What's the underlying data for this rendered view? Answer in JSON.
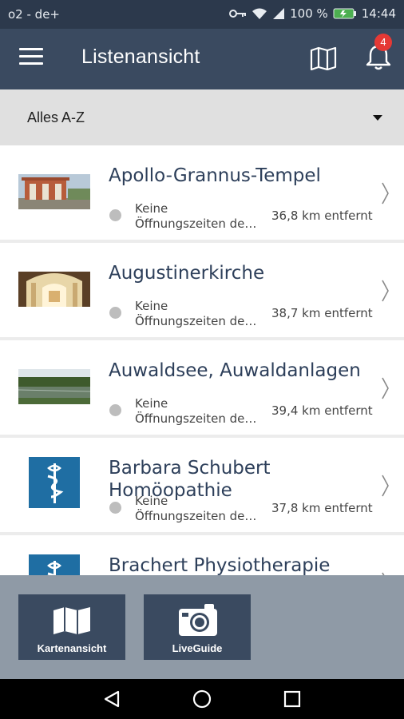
{
  "status_bar": {
    "carrier": "o2 - de+",
    "battery": "100 %",
    "time": "14:44"
  },
  "app_bar": {
    "title": "Listenansicht",
    "notification_count": "4"
  },
  "filter": {
    "selected": "Alles A-Z"
  },
  "items": [
    {
      "name": "Apollo-Grannus-Tempel",
      "hours_line1": "Keine",
      "hours_line2": "Öffnungszeiten de…",
      "distance": "36,8 km entfernt",
      "image": "photo-temple"
    },
    {
      "name": "Augustinerkirche",
      "hours_line1": "Keine",
      "hours_line2": "Öffnungszeiten de…",
      "distance": "38,7 km entfernt",
      "image": "photo-church-interior"
    },
    {
      "name": "Auwaldsee, Auwaldanlagen",
      "hours_line1": "Keine",
      "hours_line2": "Öffnungszeiten de…",
      "distance": "39,4 km entfernt",
      "image": "photo-lake"
    },
    {
      "name": "Barbara Schubert Homöopathie",
      "hours_line1": "Keine",
      "hours_line2": "Öffnungszeiten de…",
      "distance": "37,8 km entfernt",
      "image": "medical-logo"
    },
    {
      "name": "Brachert Physiotherapie",
      "image": "medical-logo"
    }
  ],
  "bottom_buttons": {
    "map_label": "Kartenansicht",
    "liveguide_label": "LiveGuide"
  },
  "colors": {
    "app_bar": "#3a4a60",
    "status_bar": "#2c394c",
    "title_text": "#2d3f5a",
    "badge": "#e53935",
    "medical_logo": "#1f6ea3"
  }
}
